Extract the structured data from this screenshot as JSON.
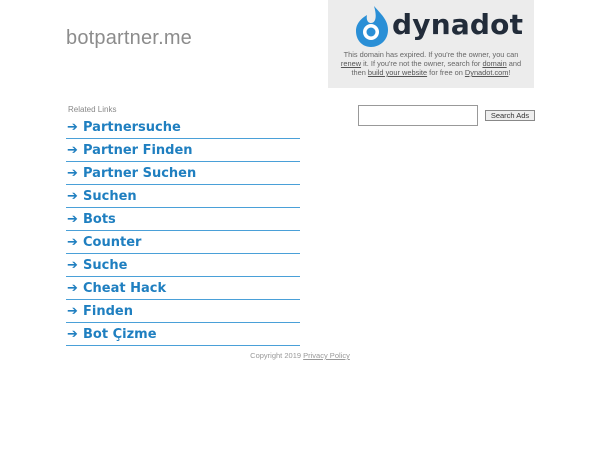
{
  "header": {
    "domain": "botpartner.me"
  },
  "dynadot": {
    "logo_text": "dynadot",
    "note_part1": "This domain has expired. If you're the owner, you can",
    "renew_link": "renew",
    "note_part2": "it. If you're not the owner, search for",
    "domain_link": "domain",
    "note_part3": "and then",
    "build_link": "build your website",
    "note_part4": "for free on",
    "dynadot_link": "Dynadot.com",
    "note_part5": "!",
    "colors": {
      "logo_blue": "#2a8fd6",
      "box_bg": "#ececec",
      "logo_text": "#222c3a"
    }
  },
  "related": {
    "label": "Related Links",
    "items": [
      {
        "label": "Partnersuche"
      },
      {
        "label": "Partner Finden"
      },
      {
        "label": "Partner Suchen"
      },
      {
        "label": "Suchen"
      },
      {
        "label": "Bots"
      },
      {
        "label": "Counter"
      },
      {
        "label": "Suche"
      },
      {
        "label": "Cheat Hack"
      },
      {
        "label": "Finden"
      },
      {
        "label": "Bot Çizme"
      }
    ],
    "arrow_icon": "arrow-right-icon",
    "link_color": "#1f7fc0"
  },
  "search": {
    "input_value": "",
    "button_label": "Search Ads"
  },
  "footer": {
    "copyright": "Copyright 2019",
    "privacy_link": "Privacy Policy"
  }
}
